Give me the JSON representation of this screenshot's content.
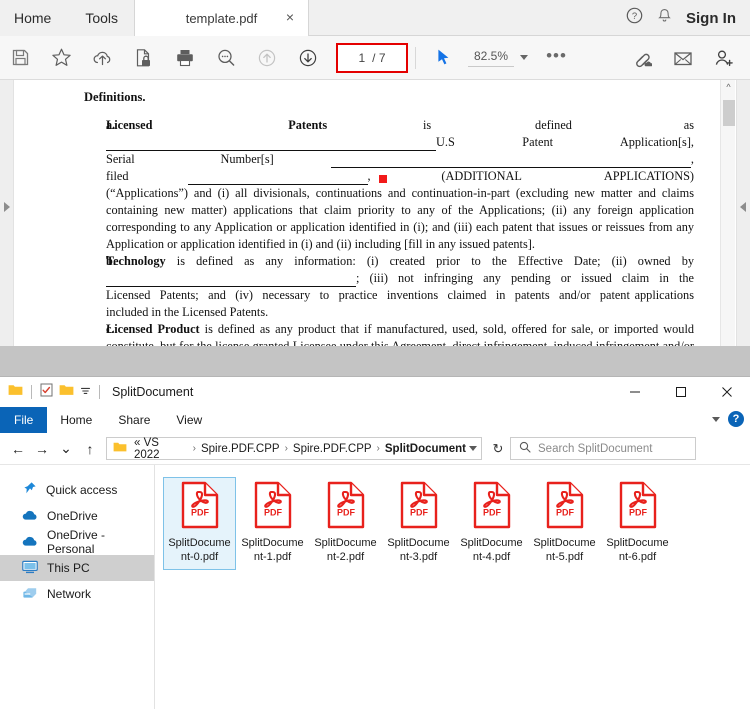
{
  "acrobat": {
    "menu": [
      {
        "label": "Home",
        "name": "menu-home"
      },
      {
        "label": "Tools",
        "name": "menu-tools"
      }
    ],
    "tab": {
      "title": "template.pdf",
      "close": "×"
    },
    "right": {
      "help_icon": "help-circle-icon",
      "bell_icon": "bell-icon",
      "sign_in": "Sign In"
    },
    "toolbar": {
      "icons": [
        {
          "name": "save-icon",
          "title": "Save"
        },
        {
          "name": "star-icon",
          "title": "Add to favorites"
        },
        {
          "name": "cloud-upload-icon",
          "title": "Upload to cloud"
        },
        {
          "name": "protect-document-icon",
          "title": "Protect"
        },
        {
          "name": "print-icon",
          "title": "Print"
        },
        {
          "name": "search-icon",
          "title": "Find"
        },
        {
          "name": "arrow-up-icon",
          "title": "Previous page"
        },
        {
          "name": "arrow-down-icon",
          "title": "Next page"
        }
      ],
      "page_current": "1",
      "page_total": "/ 7",
      "select-tool": "cursor-arrow-icon",
      "zoom_level": "82.5%",
      "more_label": "•••",
      "right_icons": [
        {
          "name": "share-link-icon"
        },
        {
          "name": "email-icon"
        },
        {
          "name": "add-person-icon"
        }
      ]
    },
    "document": {
      "heading": "Definitions.",
      "items": [
        {
          "mark": "a.",
          "lines": [
            "<b>Licensed&nbsp;&nbsp;&nbsp;&nbsp;&nbsp;&nbsp;&nbsp;&nbsp;&nbsp;&nbsp;&nbsp;&nbsp;&nbsp;&nbsp;&nbsp;&nbsp;&nbsp;Patents</b>&nbsp;&nbsp;&nbsp;&nbsp;&nbsp;&nbsp;&nbsp;&nbsp;&nbsp;&nbsp;&nbsp;&nbsp;is&nbsp;&nbsp;&nbsp;&nbsp;&nbsp;&nbsp;&nbsp;&nbsp;&nbsp;&nbsp;&nbsp;&nbsp;&nbsp;defined&nbsp;&nbsp;&nbsp;&nbsp;&nbsp;&nbsp;&nbsp;&nbsp;&nbsp;&nbsp;&nbsp;&nbsp;&nbsp;&nbsp;as",
            "<span class=\"ul\" style=\"width:330px\"></span>U.S&nbsp; Patent&nbsp; Application[s],",
            "Serial&nbsp;&nbsp; Number[s]&nbsp; <span class=\"ul\" style=\"width:360px\"></span>,",
            "filed&nbsp;&nbsp;&nbsp;&nbsp; <span class=\"ul\" style=\"width:180px\"></span>,&nbsp;&nbsp;&nbsp;&nbsp;&nbsp; (ADDITIONAL&nbsp;&nbsp;&nbsp;&nbsp;&nbsp;&nbsp; APPLICATIONS)",
            "(“Applications”) and (i) all divisionals, continuations and continuation-in-part (excluding new matter and claims containing new matter) applications that claim priority to any of the Applications; (ii) any foreign application corresponding to any Application or application identified in (i); and (iii) each patent that issues or reissues from any Application or application identified in (i) and (ii) including [fill in any issued patents]."
          ]
        },
        {
          "mark": "b.",
          "lines": [
            "<b>Technology</b> is defined as any information: (i) created prior to the Effective Date; (ii) owned by",
            "<span class=\"ul\" style=\"width:250px\"></span>; (iii) not infringing any pending or issued claim in the",
            "Licensed&nbsp; Patents;&nbsp; and&nbsp; (iv)&nbsp; necessary&nbsp; to&nbsp; practice&nbsp; inventions&nbsp; claimed&nbsp; in&nbsp; patents&nbsp; and/or&nbsp; patent applications included in the Licensed Patents."
          ]
        },
        {
          "mark": "c.",
          "lines": [
            "<b>Licensed Product</b> is defined as any product that if manufactured, used, sold, offered for sale, or imported would constitute, but for the license granted Licensee under this Agreement, direct infringement, induced infringement and/or contributory infringement of any pending or issued"
          ]
        }
      ]
    }
  },
  "explorer": {
    "window": {
      "title": "SplitDocument",
      "minimize": "─",
      "maximize": "☐",
      "close": "✕"
    },
    "ribbon": {
      "file": "File",
      "tabs": [
        "Home",
        "Share",
        "View"
      ],
      "help_icon": "help-question-icon",
      "collapse_icon": "chevron-down-icon"
    },
    "address": {
      "back": "←",
      "forward": "→",
      "recent": "⌄",
      "up": "↑",
      "crumbs": [
        "« VS 2022",
        "Spire.PDF.CPP",
        "Spire.PDF.CPP",
        "SplitDocument"
      ],
      "separator": "›",
      "refresh": "↻",
      "search_placeholder": "Search SplitDocument"
    },
    "nav_items": [
      {
        "label": "Quick access",
        "icon": "pin-star-icon",
        "selected": false
      },
      {
        "label": "OneDrive",
        "icon": "cloud-icon",
        "selected": false
      },
      {
        "label": "OneDrive - Personal",
        "icon": "cloud-icon",
        "selected": false
      },
      {
        "label": "This PC",
        "icon": "monitor-icon",
        "selected": true
      },
      {
        "label": "Network",
        "icon": "network-icon",
        "selected": false
      }
    ],
    "files": [
      {
        "name": "SplitDocument-0.pdf",
        "type": "PDF",
        "selected": true
      },
      {
        "name": "SplitDocument-1.pdf",
        "type": "PDF",
        "selected": false
      },
      {
        "name": "SplitDocument-2.pdf",
        "type": "PDF",
        "selected": false
      },
      {
        "name": "SplitDocument-3.pdf",
        "type": "PDF",
        "selected": false
      },
      {
        "name": "SplitDocument-4.pdf",
        "type": "PDF",
        "selected": false
      },
      {
        "name": "SplitDocument-5.pdf",
        "type": "PDF",
        "selected": false
      },
      {
        "name": "SplitDocument-6.pdf",
        "type": "PDF",
        "selected": false
      }
    ]
  },
  "colors": {
    "highlight_red": "#e40000",
    "explorer_blue": "#0a64b7",
    "selection_blue": "#e5f3fb",
    "pdf_red": "#e8211c"
  }
}
